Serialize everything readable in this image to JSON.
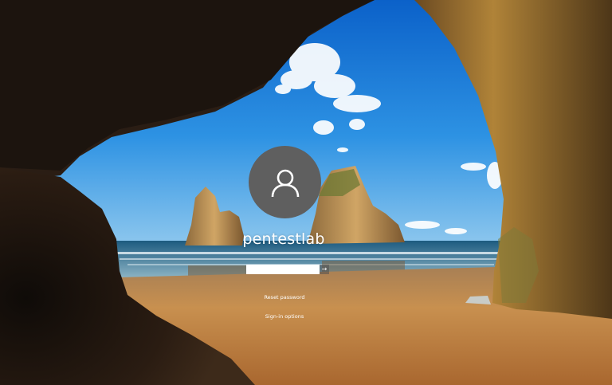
{
  "user": {
    "name": "pentestlab"
  },
  "password": {
    "value": "",
    "placeholder": "",
    "submit_glyph": "→"
  },
  "links": {
    "reset_password": "Reset password",
    "sign_in_options": "Sign-in options"
  },
  "icons": {
    "avatar": "user-icon",
    "submit": "arrow-right-icon"
  },
  "colors": {
    "avatar_bg": "#5f5f5f",
    "text": "#ffffff",
    "sky": "#1f86e0",
    "sand": "#c98e4f",
    "cave": "#1f1610"
  }
}
